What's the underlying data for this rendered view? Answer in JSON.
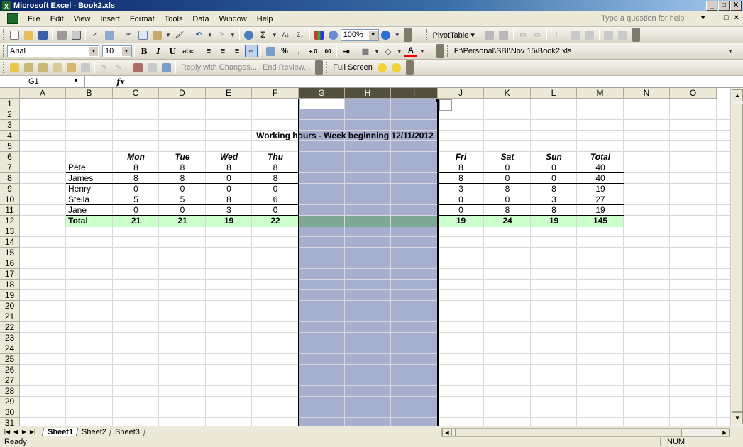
{
  "window": {
    "title": "Microsoft Excel - Book2.xls",
    "controls": [
      "_",
      "□",
      "X"
    ],
    "doc_controls": [
      "_",
      "□",
      "×"
    ]
  },
  "menu": {
    "items": [
      "File",
      "Edit",
      "View",
      "Insert",
      "Format",
      "Tools",
      "Data",
      "Window",
      "Help"
    ],
    "ask_placeholder": "Type a question for help"
  },
  "standard_toolbar": {
    "zoom": "100%",
    "pivot_table": "PivotTable ▾"
  },
  "formatting_toolbar": {
    "font": "Arial",
    "size": "10",
    "bold": "B",
    "italic": "I",
    "underline": "U",
    "strike": "abc",
    "percent": "%",
    "comma": ",",
    "file_path": "F:\\Personal\\SBI\\Nov 15\\Book2.xls"
  },
  "review_toolbar": {
    "reply": "Reply with Changes...",
    "end_review": "End Review...",
    "full_screen": "Full Screen"
  },
  "formula_bar": {
    "name_box": "G1",
    "fx": "fx",
    "content": ""
  },
  "columns": [
    "A",
    "B",
    "C",
    "D",
    "E",
    "F",
    "G",
    "H",
    "I",
    "J",
    "K",
    "L",
    "M",
    "N",
    "O"
  ],
  "rows": [
    "1",
    "2",
    "3",
    "4",
    "5",
    "6",
    "7",
    "8",
    "9",
    "10",
    "11",
    "12",
    "13",
    "14",
    "15",
    "16",
    "17",
    "18",
    "19",
    "20",
    "21",
    "22",
    "23",
    "24",
    "25",
    "26",
    "27",
    "28",
    "29",
    "30",
    "31"
  ],
  "sheet": {
    "heading": "Working hours - Week beginning 12/11/2012",
    "day_headers": [
      "Mon",
      "Tue",
      "Wed",
      "Thu",
      "Fri",
      "Sat",
      "Sun",
      "Total"
    ],
    "people": [
      {
        "name": "Pete",
        "values": [
          "8",
          "8",
          "8",
          "8",
          "8",
          "0",
          "0",
          "40"
        ]
      },
      {
        "name": "James",
        "values": [
          "8",
          "8",
          "0",
          "8",
          "8",
          "0",
          "0",
          "40"
        ]
      },
      {
        "name": "Henry",
        "values": [
          "0",
          "0",
          "0",
          "0",
          "3",
          "8",
          "8",
          "19"
        ]
      },
      {
        "name": "Stella",
        "values": [
          "5",
          "5",
          "8",
          "6",
          "0",
          "0",
          "3",
          "27"
        ]
      },
      {
        "name": "Jane",
        "values": [
          "0",
          "0",
          "3",
          "0",
          "0",
          "8",
          "8",
          "19"
        ]
      }
    ],
    "total_label": "Total",
    "totals": [
      "21",
      "21",
      "19",
      "22",
      "19",
      "24",
      "19",
      "145"
    ]
  },
  "tabs": [
    "Sheet1",
    "Sheet2",
    "Sheet3"
  ],
  "status": {
    "ready": "Ready",
    "num": "NUM"
  }
}
